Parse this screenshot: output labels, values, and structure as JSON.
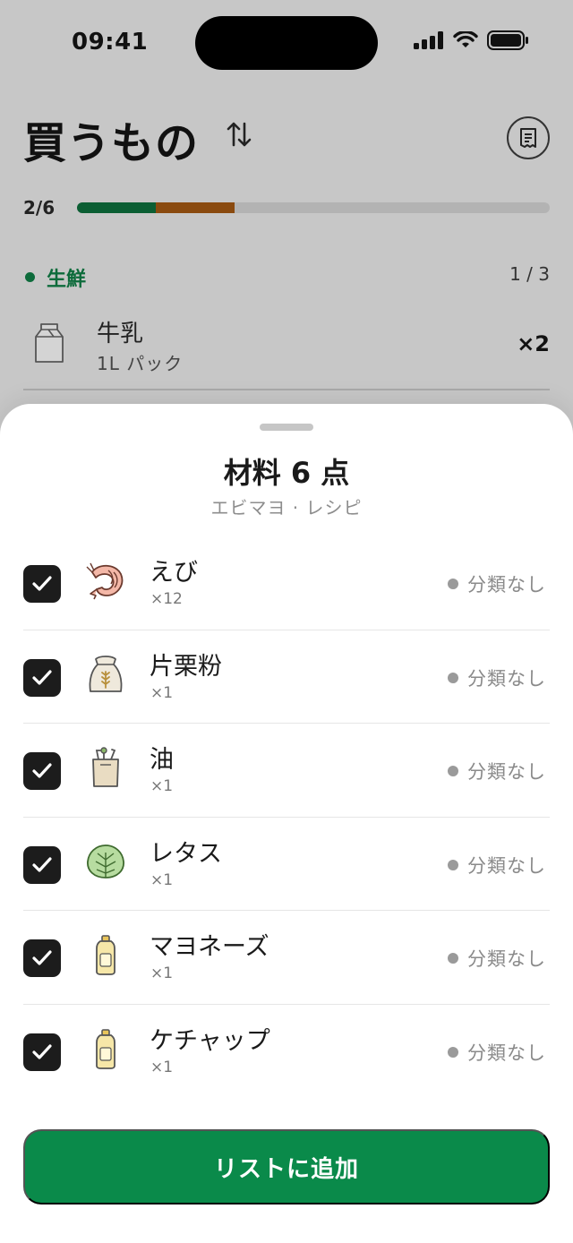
{
  "status_bar": {
    "time": "09:41"
  },
  "header": {
    "title": "買うもの"
  },
  "progress": {
    "label": "2/6",
    "segments": [
      {
        "fraction": 0.167,
        "color": "#0b5e33"
      },
      {
        "fraction": 0.167,
        "color": "#8a4a0f"
      }
    ]
  },
  "category": {
    "name": "生鮮",
    "count": "1 / 3",
    "color": "#0d6b3b"
  },
  "background_item": {
    "name": "牛乳",
    "sub": "1L パック",
    "qty": "×2"
  },
  "sheet": {
    "title": "材料 6 点",
    "subtitle": "エビマヨ · レシピ",
    "items": [
      {
        "name": "えび",
        "qty": "×12",
        "category": "分類なし",
        "checked": true,
        "icon": "shrimp-icon"
      },
      {
        "name": "片栗粉",
        "qty": "×1",
        "category": "分類なし",
        "checked": true,
        "icon": "flour-bag-icon"
      },
      {
        "name": "油",
        "qty": "×1",
        "category": "分類なし",
        "checked": true,
        "icon": "grocery-bag-icon"
      },
      {
        "name": "レタス",
        "qty": "×1",
        "category": "分類なし",
        "checked": true,
        "icon": "lettuce-icon"
      },
      {
        "name": "マヨネーズ",
        "qty": "×1",
        "category": "分類なし",
        "checked": true,
        "icon": "sauce-bottle-icon"
      },
      {
        "name": "ケチャップ",
        "qty": "×1",
        "category": "分類なし",
        "checked": true,
        "icon": "sauce-bottle-icon"
      }
    ],
    "add_button": "リストに追加",
    "accent": "#0a8a4a"
  }
}
